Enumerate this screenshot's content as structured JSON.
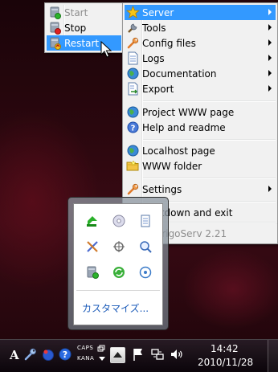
{
  "main_menu": {
    "items": [
      {
        "label": "Server",
        "icon": "star-icon",
        "submenu": true,
        "highlighted": true
      },
      {
        "label": "Tools",
        "icon": "tools-icon",
        "submenu": true
      },
      {
        "label": "Config files",
        "icon": "wrench-icon",
        "submenu": true
      },
      {
        "label": "Logs",
        "icon": "document-icon",
        "submenu": true
      },
      {
        "label": "Documentation",
        "icon": "globe-icon",
        "submenu": true
      },
      {
        "label": "Export",
        "icon": "export-icon",
        "submenu": true
      },
      {
        "label": "Project WWW page",
        "icon": "globe-icon"
      },
      {
        "label": "Help and readme",
        "icon": "help-icon"
      },
      {
        "label": "Localhost page",
        "icon": "globe-icon"
      },
      {
        "label": "WWW folder",
        "icon": "folder-icon"
      },
      {
        "label": "Settings",
        "icon": "wrench-icon",
        "submenu": true
      },
      {
        "label": "Shutdown and exit",
        "icon": "close-icon"
      },
      {
        "label": "VertrigoServ 2.21",
        "icon": "info-icon",
        "disabled": true
      }
    ]
  },
  "server_submenu": {
    "items": [
      {
        "label": "Start",
        "icon": "server-start-icon",
        "disabled": true
      },
      {
        "label": "Stop",
        "icon": "server-stop-icon"
      },
      {
        "label": "Restart",
        "icon": "server-restart-icon",
        "highlighted": true
      }
    ]
  },
  "tray_popup": {
    "customize_label": "カスタマイズ..."
  },
  "taskbar": {
    "ime_label": "A",
    "caps_label": "CAPS",
    "kana_label": "KANA",
    "time": "14:42",
    "date": "2010/11/28"
  },
  "colors": {
    "highlight": "#3399ff",
    "menu_bg": "#f1f1f1",
    "link": "#1a5ab8"
  }
}
